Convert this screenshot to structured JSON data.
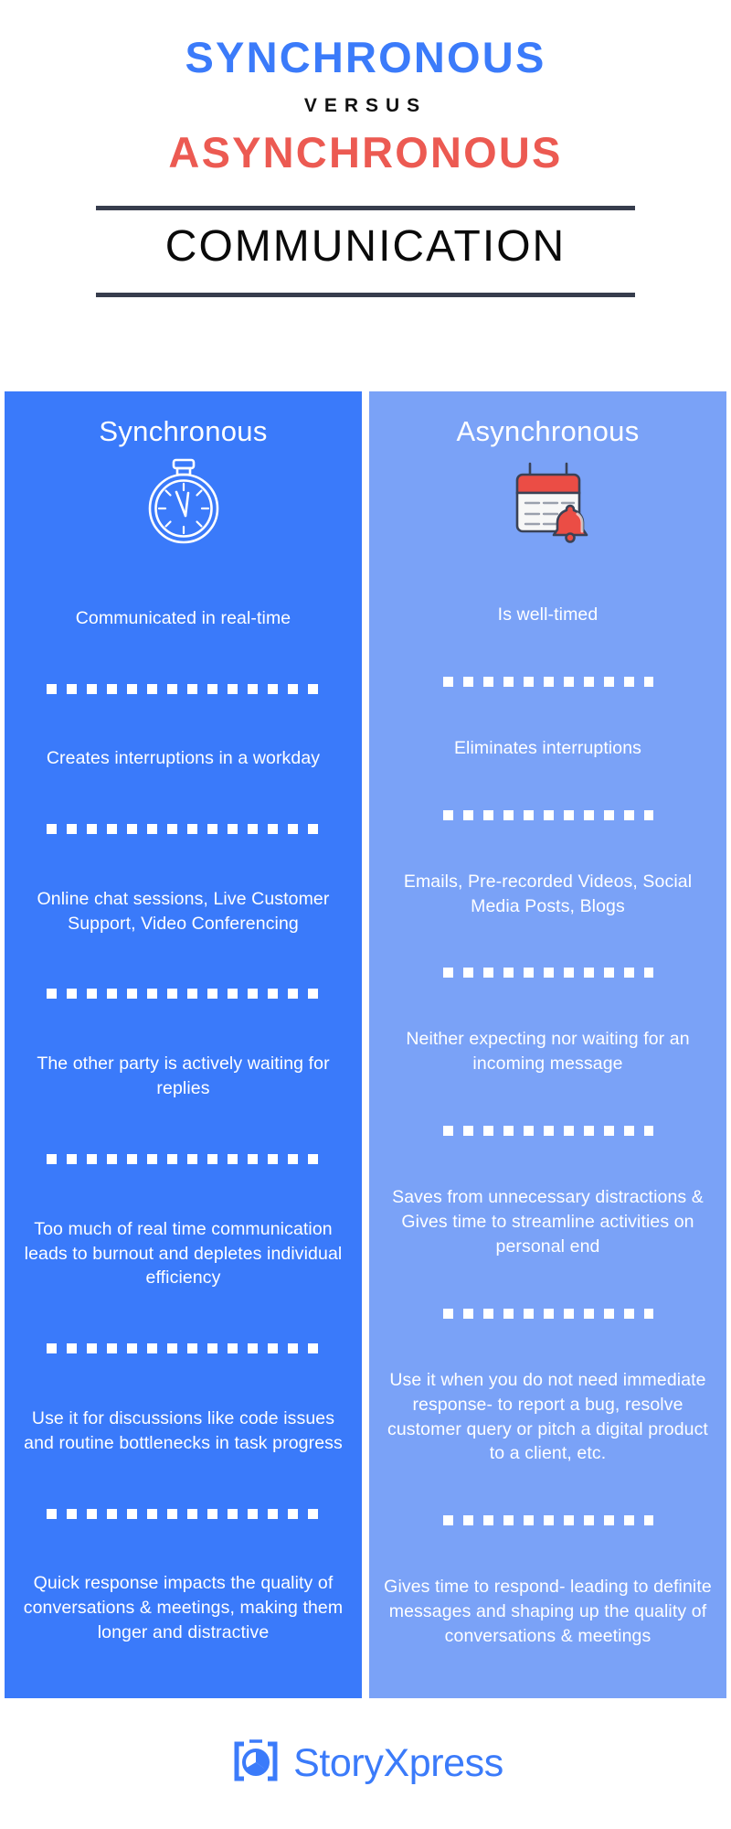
{
  "header": {
    "line1": "SYNCHRONOUS",
    "line2": "VERSUS",
    "line3": "ASYNCHRONOUS",
    "line4": "COMMUNICATION",
    "colors": {
      "sync_blue": "#3b7bfa",
      "async_red": "#ec5a52",
      "rule_navy": "#373d4d",
      "comm_black": "#0a0a0a"
    }
  },
  "columns": {
    "left": {
      "heading": "Synchronous",
      "icon": "stopwatch-icon",
      "background": "#3a7afa",
      "items": [
        "Communicated in real-time",
        "Creates interruptions in a workday",
        "Online chat sessions, Live Customer Support, Video Conferencing",
        "The other party is actively waiting for replies",
        "Too much of real time communication leads to burnout and depletes individual efficiency",
        "Use it for discussions like code issues and routine bottlenecks in task progress",
        "Quick response impacts the quality of conversations & meetings, making them longer and distractive"
      ]
    },
    "right": {
      "heading": "Asynchronous",
      "icon": "calendar-bell-icon",
      "background": "#7aa2f7",
      "items": [
        "Is well-timed",
        "Eliminates interruptions",
        "Emails, Pre-recorded Videos, Social Media Posts, Blogs",
        "Neither expecting nor waiting for an incoming message",
        "Saves from unnecessary distractions & Gives time to streamline activities on personal end",
        "Use it when you do not need immediate response- to report a bug, resolve customer query or pitch a digital product to a client, etc.",
        "Gives time to respond- leading to definite messages and shaping up the quality of conversations & meetings"
      ]
    }
  },
  "footer": {
    "brand": "StoryXpress",
    "logo_icon": "storyxpress-play-bracket-icon",
    "brand_color": "#3b7bfa"
  }
}
